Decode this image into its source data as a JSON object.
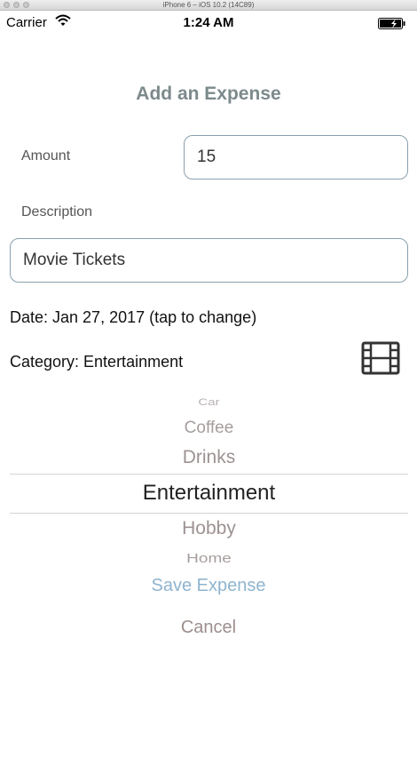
{
  "simulator": {
    "title": "iPhone 6 – iOS 10.2 (14C89)"
  },
  "status_bar": {
    "carrier": "Carrier",
    "time": "1:24 AM"
  },
  "form": {
    "title": "Add an Expense",
    "amount_label": "Amount",
    "amount_value": "15",
    "description_label": "Description",
    "description_value": "Movie Tickets",
    "date_text": "Date: Jan 27, 2017 (tap to change)",
    "category_text": "Category: Entertainment"
  },
  "picker": {
    "items": [
      "Car",
      "Coffee",
      "Drinks",
      "Entertainment",
      "Hobby",
      "Home"
    ],
    "selected": "Entertainment"
  },
  "actions": {
    "save_label": "Save Expense",
    "cancel_label": "Cancel"
  },
  "colors": {
    "title": "#7d8a8c",
    "save": "#8fb4cf",
    "cancel": "#9d8e8e",
    "field_border": "#8aa0ad"
  }
}
